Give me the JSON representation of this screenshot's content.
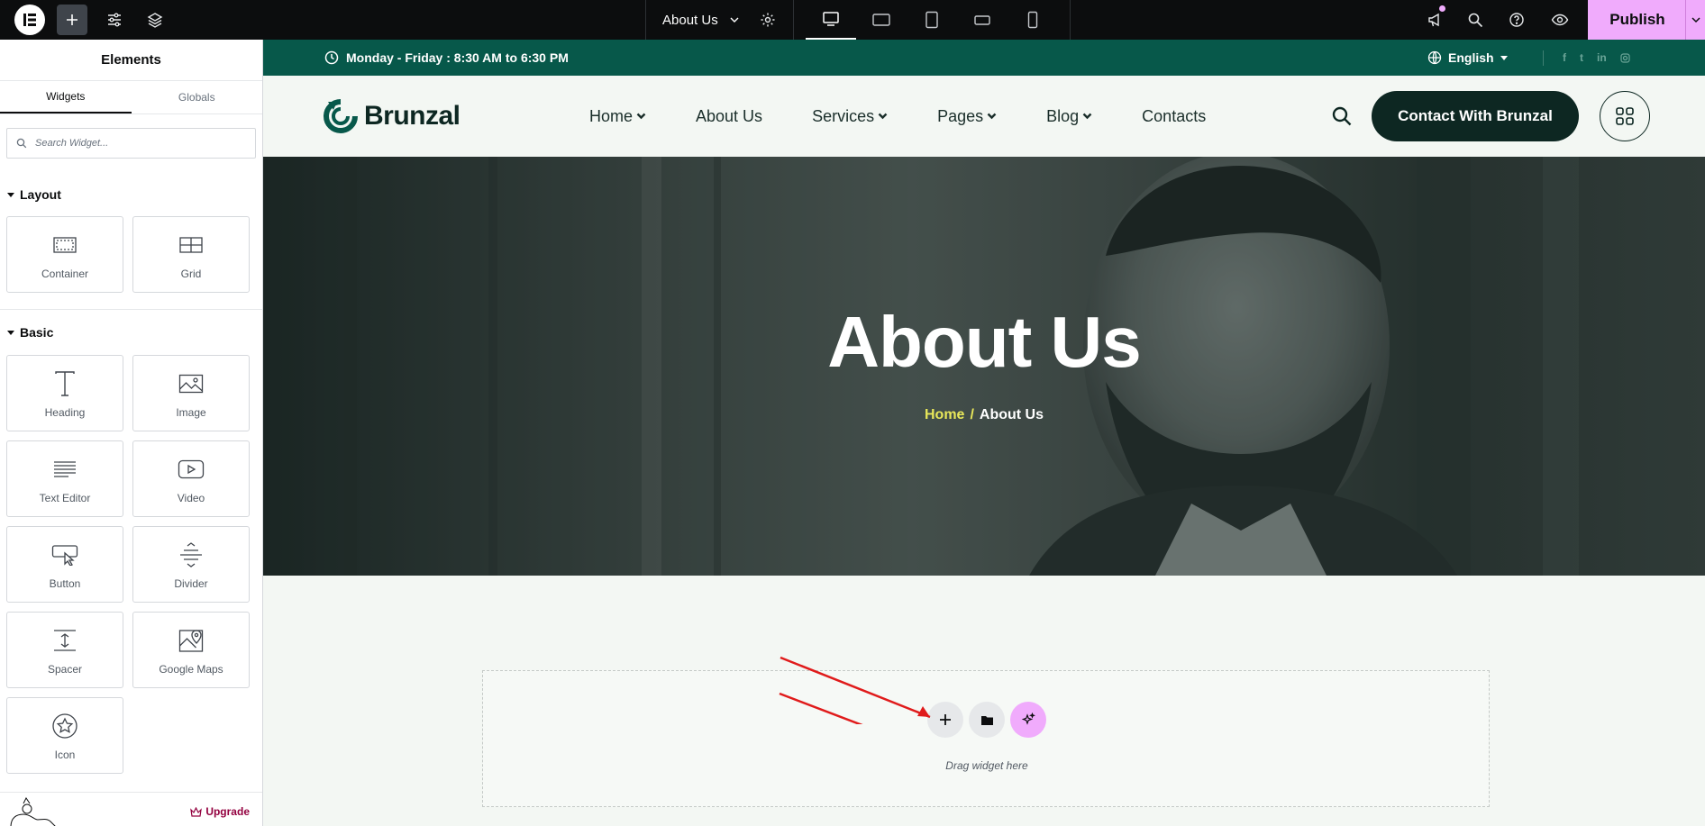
{
  "topbar": {
    "page_title": "About Us",
    "publish_label": "Publish",
    "devices": [
      "desktop-icon",
      "tablet-landscape-icon",
      "tablet-icon",
      "mobile-landscape-icon",
      "mobile-icon"
    ]
  },
  "sidebar": {
    "title": "Elements",
    "tabs": [
      "Widgets",
      "Globals"
    ],
    "search_placeholder": "Search Widget...",
    "categories": {
      "layout": "Layout",
      "basic": "Basic"
    },
    "layout_widgets": [
      {
        "label": "Container",
        "icon": "container-icon"
      },
      {
        "label": "Grid",
        "icon": "grid-icon"
      }
    ],
    "basic_widgets": [
      {
        "label": "Heading",
        "icon": "heading-icon"
      },
      {
        "label": "Image",
        "icon": "image-icon"
      },
      {
        "label": "Text Editor",
        "icon": "text-editor-icon"
      },
      {
        "label": "Video",
        "icon": "video-icon"
      },
      {
        "label": "Button",
        "icon": "button-icon"
      },
      {
        "label": "Divider",
        "icon": "divider-icon"
      },
      {
        "label": "Spacer",
        "icon": "spacer-icon"
      },
      {
        "label": "Google Maps",
        "icon": "google-maps-icon"
      },
      {
        "label": "Icon",
        "icon": "star-icon"
      }
    ],
    "upgrade_label": "Upgrade"
  },
  "site": {
    "hours": "Monday - Friday : 8:30 AM to 6:30 PM",
    "language": "English",
    "socials": [
      "f",
      "t",
      "in",
      "ig"
    ],
    "brand": "Brunzal",
    "nav": [
      {
        "label": "Home",
        "dropdown": true
      },
      {
        "label": "About Us",
        "dropdown": false
      },
      {
        "label": "Services",
        "dropdown": true
      },
      {
        "label": "Pages",
        "dropdown": true
      },
      {
        "label": "Blog",
        "dropdown": true
      },
      {
        "label": "Contacts",
        "dropdown": false
      }
    ],
    "cta": "Contact With Brunzal",
    "hero_title": "About Us",
    "breadcrumb": {
      "home": "Home",
      "sep": "/",
      "current": "About Us"
    },
    "drop_text": "Drag widget here"
  },
  "colors": {
    "accent_pink": "#f0abfc",
    "brand_green": "#07584a",
    "brand_dark": "#0d2722",
    "crumb_yellow": "#e8e75a",
    "upgrade": "#93003f"
  }
}
